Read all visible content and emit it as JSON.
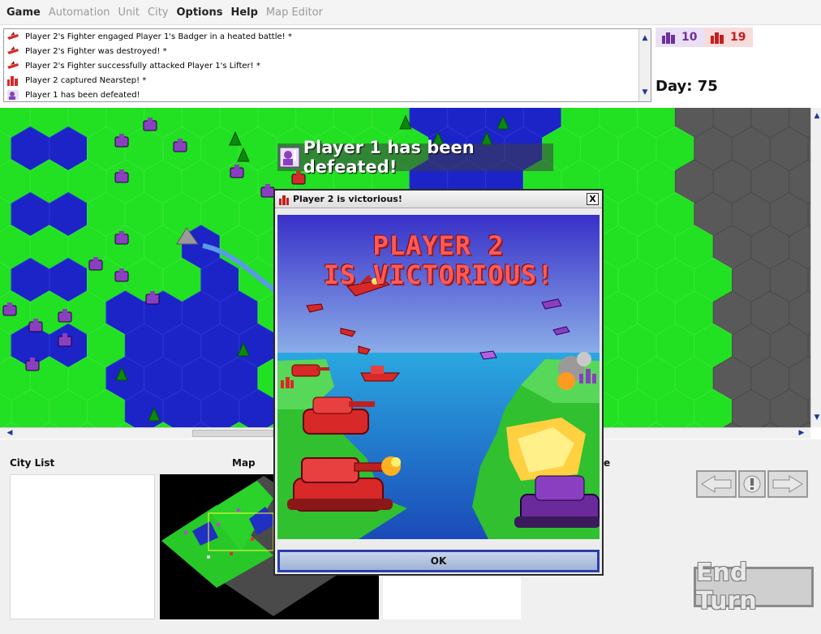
{
  "menu": {
    "items": [
      {
        "label": "Game",
        "enabled": true
      },
      {
        "label": "Automation",
        "enabled": false
      },
      {
        "label": "Unit",
        "enabled": false
      },
      {
        "label": "City",
        "enabled": false
      },
      {
        "label": "Options",
        "enabled": true
      },
      {
        "label": "Help",
        "enabled": true
      },
      {
        "label": "Map Editor",
        "enabled": false
      }
    ]
  },
  "log": {
    "lines": [
      {
        "icon": "fighter-icon",
        "text": "Player 2's Fighter engaged Player 1's Badger in a heated battle! *"
      },
      {
        "icon": "fighter-icon",
        "text": "Player 2's Fighter was destroyed! *"
      },
      {
        "icon": "fighter-icon",
        "text": "Player 2's Fighter successfully attacked Player 1's Lifter! *"
      },
      {
        "icon": "city-icon",
        "text": "Player 2 captured Nearstep! *"
      },
      {
        "icon": "defeated-icon",
        "text": "Player 1 has been defeated!"
      }
    ]
  },
  "scores": {
    "player1": "10",
    "player2": "19"
  },
  "day": "Day: 75",
  "banner": {
    "text": "Player 1 has been defeated!"
  },
  "dialog": {
    "title": "Player 2 is victorious!",
    "headline_line1": "PLAYER 2",
    "headline_line2": "IS VICTORIOUS!",
    "ok_label": "OK",
    "close_label": "X"
  },
  "panels": {
    "city_list": "City List",
    "map": "Map",
    "partial_label": "e"
  },
  "end_turn": "End Turn",
  "colors": {
    "player1": "#7a2fb0",
    "player2": "#d42a2a",
    "grass": "#22e022",
    "water": "#1c24c8",
    "fog": "#595959"
  }
}
